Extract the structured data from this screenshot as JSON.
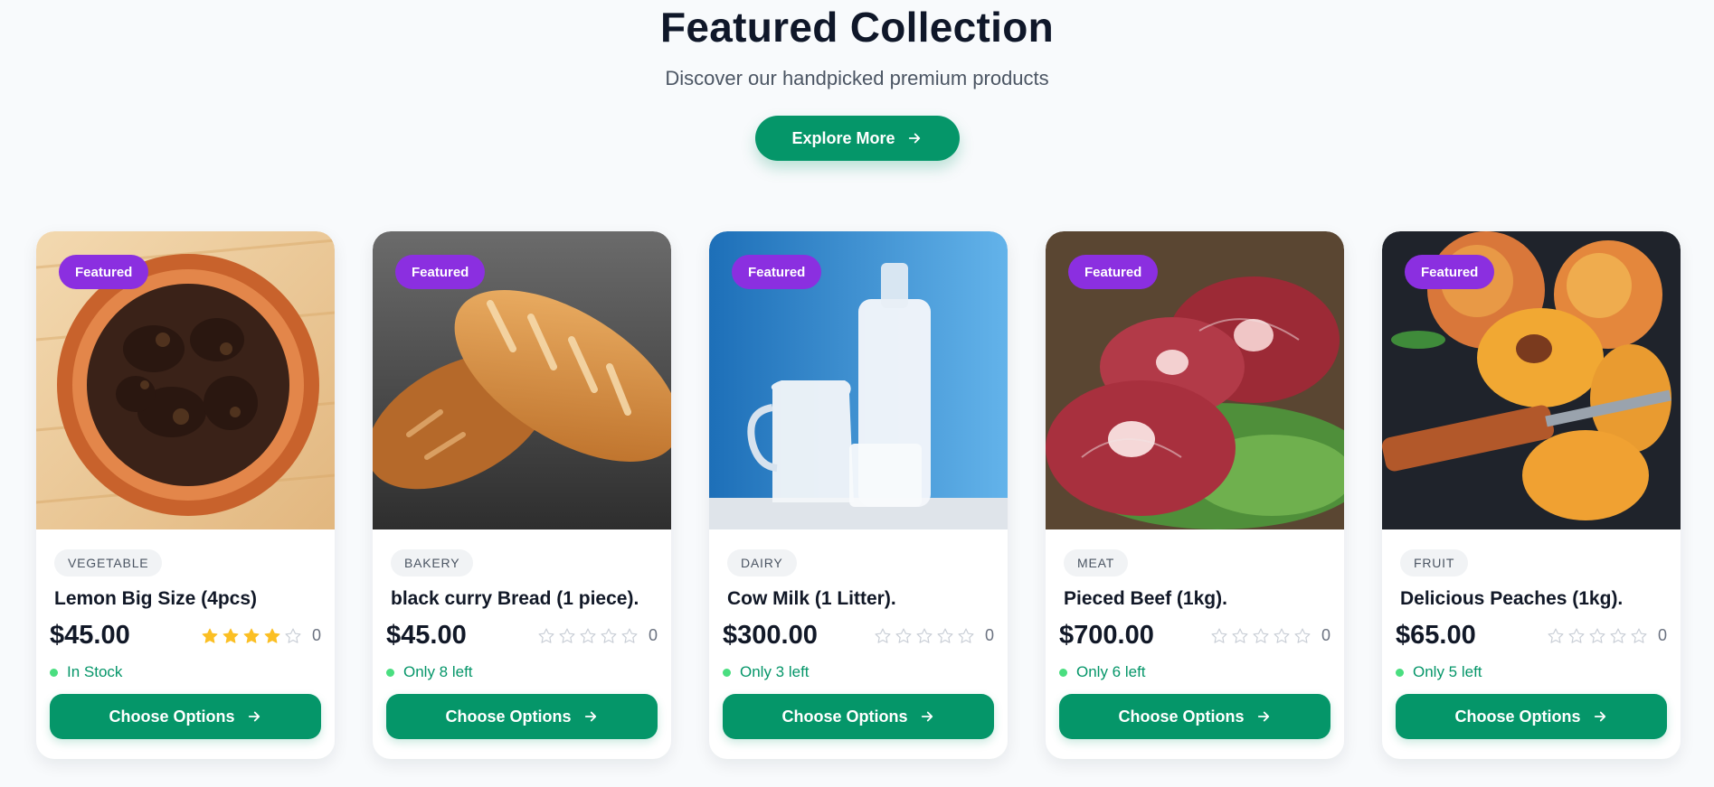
{
  "section": {
    "title": "Featured Collection",
    "subtitle": "Discover our handpicked premium products",
    "explore_label": "Explore More"
  },
  "colors": {
    "accent": "#059669",
    "badge": "#8b2fe0",
    "star_filled": "#fbbf24",
    "star_empty": "#c9ced6"
  },
  "products": [
    {
      "badge": "Featured",
      "category": "VEGETABLE",
      "name": "Lemon Big Size (4pcs)",
      "price": "$45.00",
      "rating": 4,
      "max_rating": 5,
      "review_count": "0",
      "stock": "In Stock",
      "button": "Choose Options",
      "image": "bowl-of-meat"
    },
    {
      "badge": "Featured",
      "category": "BAKERY",
      "name": "black curry Bread (1 piece).",
      "price": "$45.00",
      "rating": 0,
      "max_rating": 5,
      "review_count": "0",
      "stock": "Only 8 left",
      "button": "Choose Options",
      "image": "bread-loaves"
    },
    {
      "badge": "Featured",
      "category": "DAIRY",
      "name": "Cow Milk (1 Litter).",
      "price": "$300.00",
      "rating": 0,
      "max_rating": 5,
      "review_count": "0",
      "stock": "Only 3 left",
      "button": "Choose Options",
      "image": "milk-bottles"
    },
    {
      "badge": "Featured",
      "category": "MEAT",
      "name": "Pieced Beef (1kg).",
      "price": "$700.00",
      "rating": 0,
      "max_rating": 5,
      "review_count": "0",
      "stock": "Only 6 left",
      "button": "Choose Options",
      "image": "raw-beef"
    },
    {
      "badge": "Featured",
      "category": "FRUIT",
      "name": "Delicious Peaches (1kg).",
      "price": "$65.00",
      "rating": 0,
      "max_rating": 5,
      "review_count": "0",
      "stock": "Only 5 left",
      "button": "Choose Options",
      "image": "peaches"
    }
  ]
}
